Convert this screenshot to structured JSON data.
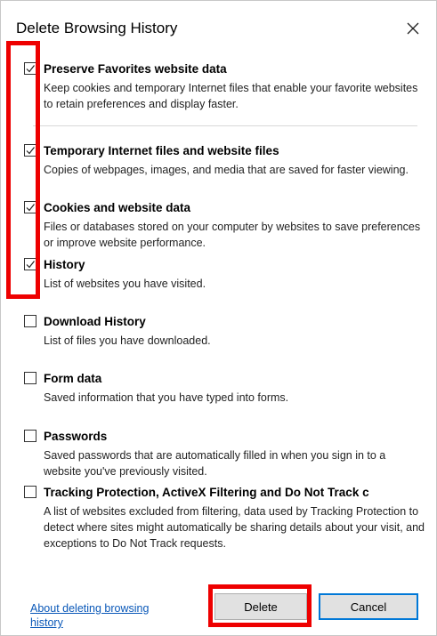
{
  "dialog": {
    "title": "Delete Browsing History",
    "close_icon": "close-icon"
  },
  "options": [
    {
      "label": "Preserve Favorites website data",
      "checked": true,
      "description": "Keep cookies and temporary Internet files that enable your favorite websites to retain preferences and display faster."
    },
    {
      "label": "Temporary Internet files and website files",
      "checked": true,
      "description": "Copies of webpages, images, and media that are saved for faster viewing."
    },
    {
      "label": "Cookies and website data",
      "checked": true,
      "description": "Files or databases stored on your computer by websites to save preferences or improve website performance."
    },
    {
      "label": "History",
      "checked": true,
      "description": "List of websites you have visited."
    },
    {
      "label": "Download History",
      "checked": false,
      "description": "List of files you have downloaded."
    },
    {
      "label": "Form data",
      "checked": false,
      "description": "Saved information that you have typed into forms."
    },
    {
      "label": "Passwords",
      "checked": false,
      "description": "Saved passwords that are automatically filled in when you sign in to a website you've previously visited."
    },
    {
      "label": "Tracking Protection, ActiveX Filtering and Do Not Track c",
      "checked": false,
      "description": "A list of websites excluded from filtering, data used by Tracking Protection to detect where sites might automatically be sharing details about your visit, and exceptions to Do Not Track requests."
    }
  ],
  "footer": {
    "link": "About deleting browsing history",
    "delete_label": "Delete",
    "cancel_label": "Cancel"
  },
  "colors": {
    "highlight": "#ee0000",
    "link": "#0a58b8",
    "focus_border": "#0078d7"
  }
}
